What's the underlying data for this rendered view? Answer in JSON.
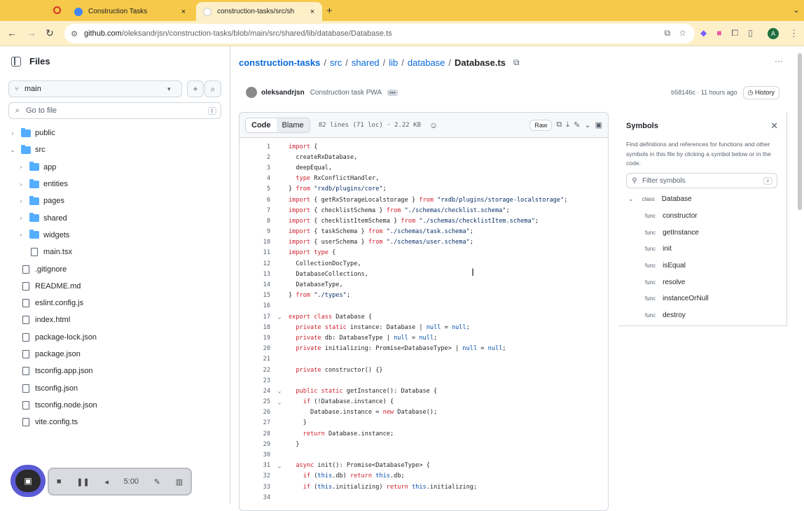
{
  "browser": {
    "tabs": [
      {
        "title": "Construction Tasks",
        "close": "×"
      },
      {
        "title": "construction-tasks/src/sh",
        "close": "×"
      }
    ],
    "new_tab": "+",
    "url_host": "github.com",
    "url_path": "/oleksandrjsn/construction-tasks/blob/main/src/shared/lib/database/Database.ts",
    "profile_initial": "A"
  },
  "sidebar": {
    "title": "Files",
    "branch": "main",
    "search_placeholder": "Go to file",
    "search_kbd": "t",
    "tree": [
      {
        "label": "public",
        "type": "folder",
        "depth": 0,
        "chevron": "›"
      },
      {
        "label": "src",
        "type": "folder",
        "depth": 0,
        "chevron": "⌄"
      },
      {
        "label": "app",
        "type": "folder",
        "depth": 1,
        "chevron": "›"
      },
      {
        "label": "entities",
        "type": "folder",
        "depth": 1,
        "chevron": "›"
      },
      {
        "label": "pages",
        "type": "folder",
        "depth": 1,
        "chevron": "›"
      },
      {
        "label": "shared",
        "type": "folder",
        "depth": 1,
        "chevron": "›"
      },
      {
        "label": "widgets",
        "type": "folder",
        "depth": 1,
        "chevron": "›"
      },
      {
        "label": "main.tsx",
        "type": "file",
        "depth": 1,
        "chevron": ""
      },
      {
        "label": ".gitignore",
        "type": "file",
        "depth": 0,
        "chevron": ""
      },
      {
        "label": "README.md",
        "type": "file",
        "depth": 0,
        "chevron": ""
      },
      {
        "label": "eslint.config.js",
        "type": "file",
        "depth": 0,
        "chevron": ""
      },
      {
        "label": "index.html",
        "type": "file",
        "depth": 0,
        "chevron": ""
      },
      {
        "label": "package-lock.json",
        "type": "file",
        "depth": 0,
        "chevron": ""
      },
      {
        "label": "package.json",
        "type": "file",
        "depth": 0,
        "chevron": ""
      },
      {
        "label": "tsconfig.app.json",
        "type": "file",
        "depth": 0,
        "chevron": ""
      },
      {
        "label": "tsconfig.json",
        "type": "file",
        "depth": 0,
        "chevron": ""
      },
      {
        "label": "tsconfig.node.json",
        "type": "file",
        "depth": 0,
        "chevron": ""
      },
      {
        "label": "vite.config.ts",
        "type": "file",
        "depth": 0,
        "chevron": ""
      }
    ]
  },
  "recorder": {
    "time": "5:00"
  },
  "breadcrumb": {
    "repo": "construction-tasks",
    "parts": [
      "src",
      "shared",
      "lib",
      "database"
    ],
    "file": "Database.ts"
  },
  "commit": {
    "author": "oleksandrjsn",
    "message": "Construction task PWA",
    "dots": "•••",
    "hash_time": "b58146c · 11 hours ago",
    "history": "History"
  },
  "code_header": {
    "code_tab": "Code",
    "blame_tab": "Blame",
    "meta": "82 lines (71 loc) · 2.22 KB",
    "raw": "Raw"
  },
  "code_lines": [
    {
      "n": "1",
      "fold": "",
      "text": "import {"
    },
    {
      "n": "2",
      "fold": "",
      "text": "  createRxDatabase,"
    },
    {
      "n": "3",
      "fold": "",
      "text": "  deepEqual,"
    },
    {
      "n": "4",
      "fold": "",
      "text": "  type RxConflictHandler,"
    },
    {
      "n": "5",
      "fold": "",
      "text": "} from \"rxdb/plugins/core\";"
    },
    {
      "n": "6",
      "fold": "",
      "text": "import { getRxStorageLocalstorage } from \"rxdb/plugins/storage-localstorage\";"
    },
    {
      "n": "7",
      "fold": "",
      "text": "import { checklistSchema } from \"./schemas/checklist.schema\";"
    },
    {
      "n": "8",
      "fold": "",
      "text": "import { checklistItemSchema } from \"./schemas/checklistItem.schema\";"
    },
    {
      "n": "9",
      "fold": "",
      "text": "import { taskSchema } from \"./schemas/task.schema\";"
    },
    {
      "n": "10",
      "fold": "",
      "text": "import { userSchema } from \"./schemas/user.schema\";"
    },
    {
      "n": "11",
      "fold": "",
      "text": "import type {"
    },
    {
      "n": "12",
      "fold": "",
      "text": "  CollectionDocType,"
    },
    {
      "n": "13",
      "fold": "",
      "text": "  DatabaseCollections,"
    },
    {
      "n": "14",
      "fold": "",
      "text": "  DatabaseType,"
    },
    {
      "n": "15",
      "fold": "",
      "text": "} from \"./types\";"
    },
    {
      "n": "16",
      "fold": "",
      "text": ""
    },
    {
      "n": "17",
      "fold": "⌄",
      "text": "export class Database {"
    },
    {
      "n": "18",
      "fold": "",
      "text": "  private static instance: Database | null = null;"
    },
    {
      "n": "19",
      "fold": "",
      "text": "  private db: DatabaseType | null = null;"
    },
    {
      "n": "20",
      "fold": "",
      "text": "  private initializing: Promise<DatabaseType> | null = null;"
    },
    {
      "n": "21",
      "fold": "",
      "text": ""
    },
    {
      "n": "22",
      "fold": "",
      "text": "  private constructor() {}"
    },
    {
      "n": "23",
      "fold": "",
      "text": ""
    },
    {
      "n": "24",
      "fold": "⌄",
      "text": "  public static getInstance(): Database {"
    },
    {
      "n": "25",
      "fold": "⌄",
      "text": "    if (!Database.instance) {"
    },
    {
      "n": "26",
      "fold": "",
      "text": "      Database.instance = new Database();"
    },
    {
      "n": "27",
      "fold": "",
      "text": "    }"
    },
    {
      "n": "28",
      "fold": "",
      "text": "    return Database.instance;"
    },
    {
      "n": "29",
      "fold": "",
      "text": "  }"
    },
    {
      "n": "30",
      "fold": "",
      "text": ""
    },
    {
      "n": "31",
      "fold": "⌄",
      "text": "  async init(): Promise<DatabaseType> {"
    },
    {
      "n": "32",
      "fold": "",
      "text": "    if (this.db) return this.db;"
    },
    {
      "n": "33",
      "fold": "",
      "text": "    if (this.initializing) return this.initializing;"
    },
    {
      "n": "34",
      "fold": "",
      "text": ""
    }
  ],
  "symbols": {
    "title": "Symbols",
    "description": "Find definitions and references for functions and other symbols in this file by clicking a symbol below or in the code.",
    "filter_placeholder": "Filter symbols",
    "filter_kbd": "r",
    "items": [
      {
        "kind": "class",
        "name": "Database",
        "depth": 0
      },
      {
        "kind": "func",
        "name": "constructor",
        "depth": 1
      },
      {
        "kind": "func",
        "name": "getInstance",
        "depth": 1
      },
      {
        "kind": "func",
        "name": "init",
        "depth": 1
      },
      {
        "kind": "func",
        "name": "isEqual",
        "depth": 1
      },
      {
        "kind": "func",
        "name": "resolve",
        "depth": 1
      },
      {
        "kind": "func",
        "name": "instanceOrNull",
        "depth": 1
      },
      {
        "kind": "func",
        "name": "destroy",
        "depth": 1
      }
    ]
  },
  "colors": {
    "browser_chrome": "#f6c94a",
    "link": "#0969da",
    "keyword": "#cf222e",
    "string": "#0a3069",
    "folder": "#54aeff"
  }
}
